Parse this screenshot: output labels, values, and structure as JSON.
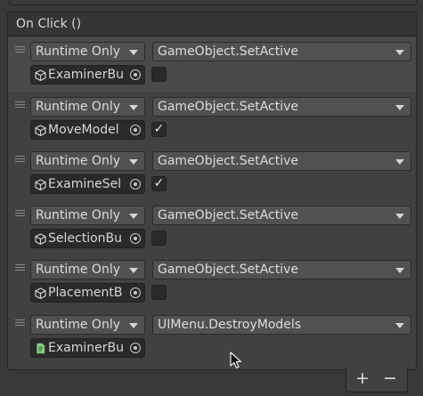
{
  "event": {
    "header": "On Click ()"
  },
  "entries": [
    {
      "mode": "Runtime Only",
      "function": "GameObject.SetActive",
      "object": "ExaminerBu",
      "object_icon": "cube-icon",
      "checked": false,
      "selected": true
    },
    {
      "mode": "Runtime Only",
      "function": "GameObject.SetActive",
      "object": "MoveModel",
      "object_icon": "cube-icon",
      "checked": true,
      "check_mark": "✓"
    },
    {
      "mode": "Runtime Only",
      "function": "GameObject.SetActive",
      "object": "ExamineSel",
      "object_icon": "cube-icon",
      "checked": true,
      "check_mark": "✓"
    },
    {
      "mode": "Runtime Only",
      "function": "GameObject.SetActive",
      "object": "SelectionBu",
      "object_icon": "cube-icon",
      "checked": false
    },
    {
      "mode": "Runtime Only",
      "function": "GameObject.SetActive",
      "object": "PlacementB",
      "object_icon": "cube-icon",
      "checked": false
    },
    {
      "mode": "Runtime Only",
      "function": "UIMenu.DestroyModels",
      "object": "ExaminerBu",
      "object_icon": "script-icon"
    }
  ],
  "footer": {
    "add_label": "+",
    "remove_label": "−"
  },
  "colors": {
    "panel": "#414141",
    "header": "#353535",
    "dropdown": "#515151",
    "field": "#2a2a2a",
    "selected_row": "#4a4a4a",
    "script_icon": "#8fd18f"
  }
}
